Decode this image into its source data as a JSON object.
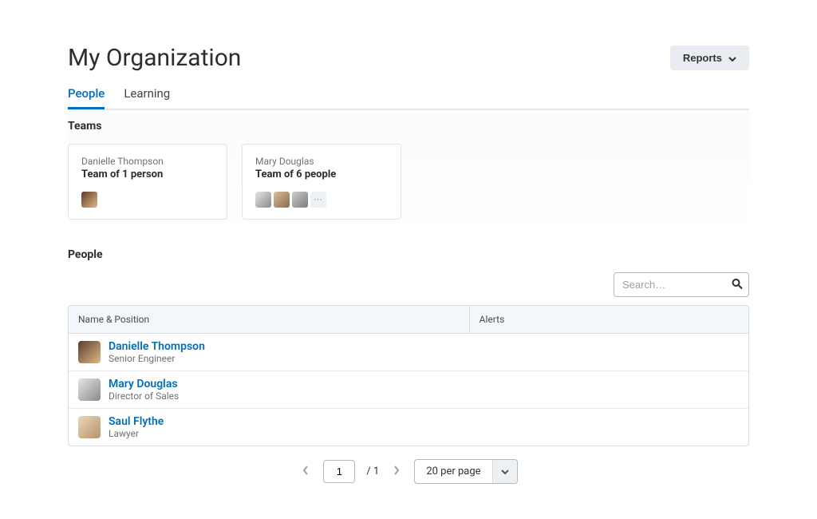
{
  "header": {
    "title": "My Organization",
    "reports_label": "Reports"
  },
  "tabs": {
    "people": "People",
    "learning": "Learning"
  },
  "teams": {
    "heading": "Teams",
    "cards": [
      {
        "owner": "Danielle Thompson",
        "size_text": "Team of 1 person"
      },
      {
        "owner": "Mary Douglas",
        "size_text": "Team of 6 people"
      }
    ],
    "more_glyph": "···"
  },
  "people": {
    "heading": "People",
    "search_placeholder": "Search…",
    "columns": {
      "name": "Name & Position",
      "alerts": "Alerts"
    },
    "rows": [
      {
        "name": "Danielle Thompson",
        "position": "Senior Engineer"
      },
      {
        "name": "Mary Douglas",
        "position": "Director of Sales"
      },
      {
        "name": "Saul Flythe",
        "position": "Lawyer"
      }
    ]
  },
  "pagination": {
    "current": "1",
    "total_text": "/ 1",
    "per_page_label": "20 per page"
  }
}
